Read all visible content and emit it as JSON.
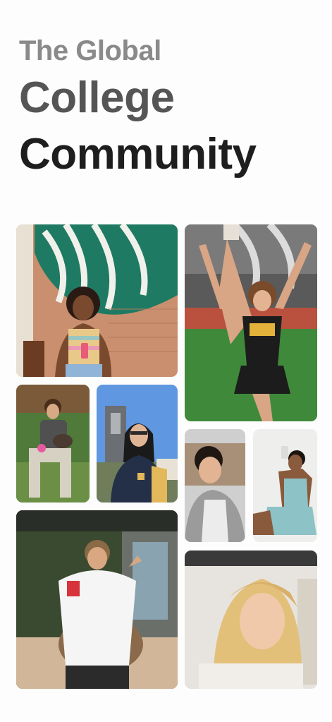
{
  "header": {
    "line1": "The Global",
    "line2": "College",
    "line3": "Community"
  },
  "photos": [
    {
      "subject": "student-starbucks-mural"
    },
    {
      "subject": "cheerleader-tigers"
    },
    {
      "subject": "student-with-dog"
    },
    {
      "subject": "student-campus-tower"
    },
    {
      "subject": "student-selfie-couch"
    },
    {
      "subject": "student-mirror-selfie"
    },
    {
      "subject": "student-patio-cup"
    },
    {
      "subject": "student-blonde-portrait"
    }
  ],
  "colors": {
    "title_light": "#8a8a8a",
    "title_mid": "#555555",
    "title_dark": "#1e1e1e",
    "background": "#fdfdfd"
  }
}
